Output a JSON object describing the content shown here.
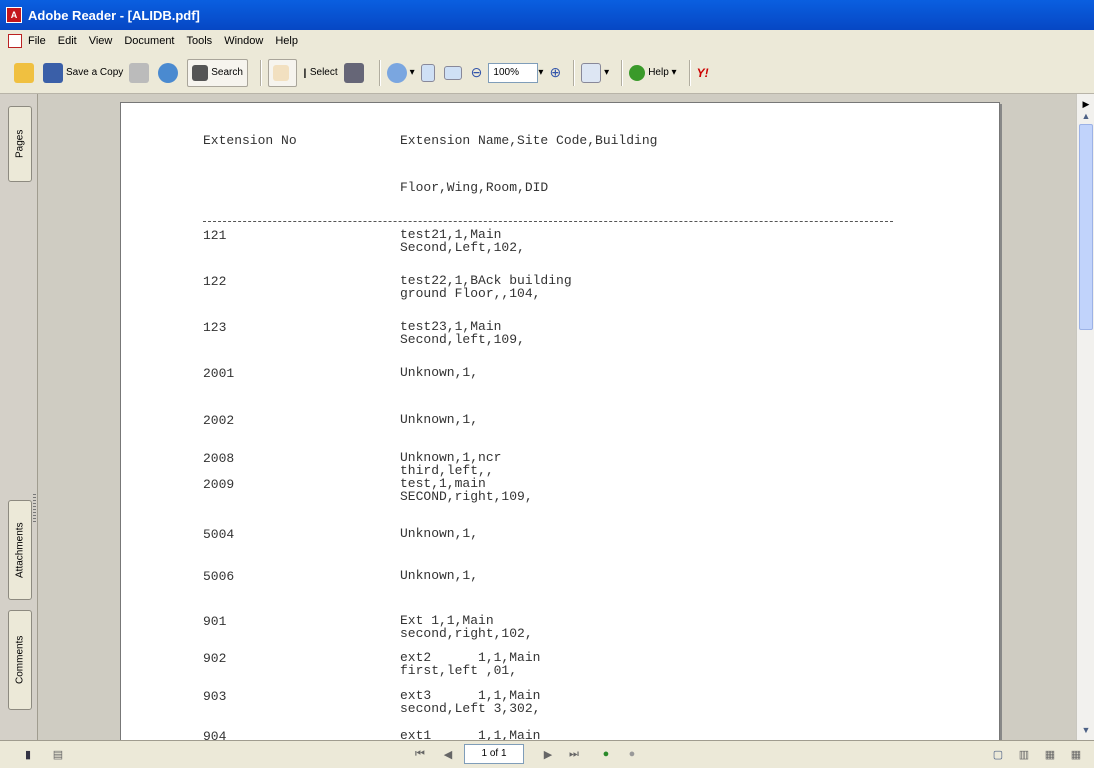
{
  "window": {
    "title": "Adobe Reader - [ALIDB.pdf]"
  },
  "menu": [
    "File",
    "Edit",
    "View",
    "Document",
    "Tools",
    "Window",
    "Help"
  ],
  "toolbar": {
    "save_copy_label": "Save a Copy",
    "search_label": "Search",
    "select_label": "Select",
    "zoom_value": "100%",
    "help_label": "Help",
    "yahoo_label": "Y!"
  },
  "side_tabs": {
    "pages": "Pages",
    "attachments": "Attachments",
    "comments": "Comments"
  },
  "document": {
    "header_col1": "Extension No",
    "header_col2": "Extension Name,Site Code,Building",
    "header_col2_line2": "Floor,Wing,Room,DID",
    "rows": [
      {
        "no": "121",
        "line1": "test21,1,Main",
        "line2": "Second,Left,102,"
      },
      {
        "no": "122",
        "line1": "test22,1,BAck building",
        "line2": "ground Floor,,104,"
      },
      {
        "no": "123",
        "line1": "test23,1,Main",
        "line2": "Second,left,109,"
      },
      {
        "no": "2001",
        "line1": "Unknown,1,",
        "line2": ""
      },
      {
        "no": "2002",
        "line1": "Unknown,1,",
        "line2": ""
      },
      {
        "no": "2008",
        "line1": "Unknown,1,ncr",
        "line2": "third,left,,"
      },
      {
        "no": "2009",
        "line1": "test,1,main",
        "line2": "SECOND,right,109,"
      },
      {
        "no": "5004",
        "line1": "Unknown,1,",
        "line2": ""
      },
      {
        "no": "5006",
        "line1": "Unknown,1,",
        "line2": ""
      },
      {
        "no": "901",
        "line1": "Ext 1,1,Main",
        "line2": "second,right,102,"
      },
      {
        "no": "902",
        "line1": "ext2      1,1,Main",
        "line2": "first,left ,01,"
      },
      {
        "no": "903",
        "line1": "ext3      1,1,Main",
        "line2": "second,Left 3,302,"
      },
      {
        "no": "904",
        "line1": "ext1      1,1,Main",
        "line2": ""
      }
    ]
  },
  "status": {
    "page_indicator": "1 of 1"
  }
}
